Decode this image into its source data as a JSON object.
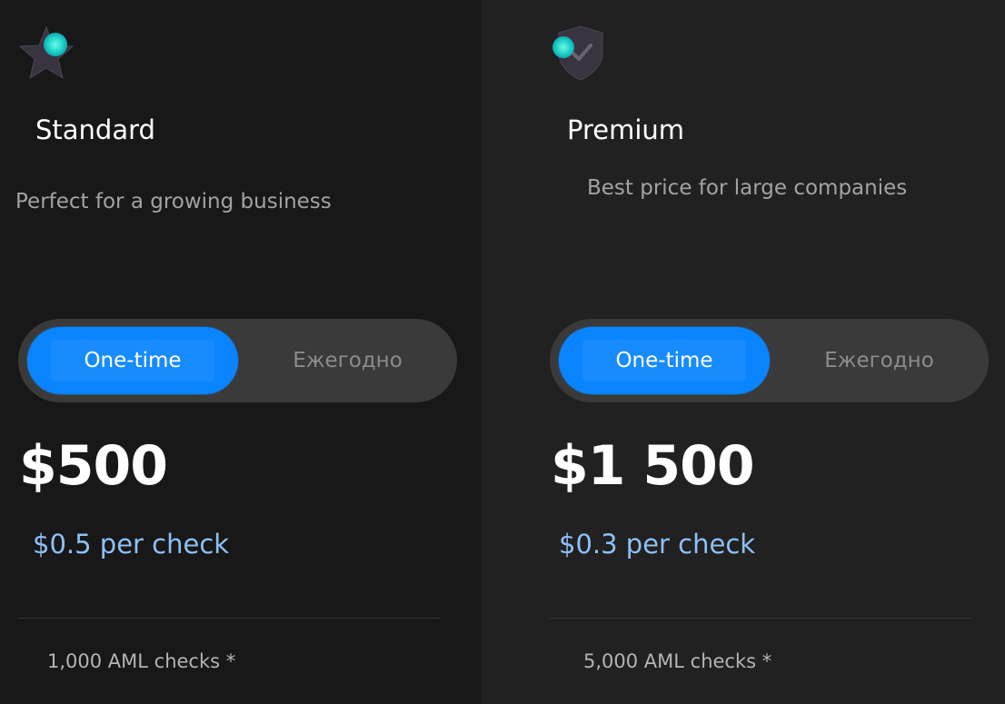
{
  "plans": [
    {
      "id": "standard",
      "icon": "star-icon",
      "title": "Standard",
      "subtitle": "Perfect for a growing business",
      "toggle": {
        "active": "One-time",
        "inactive": "Ежегодно"
      },
      "price": "$500",
      "per_check": "$0.5 per check",
      "feature": "1,000 AML checks *"
    },
    {
      "id": "premium",
      "icon": "shield-check-icon",
      "title": "Premium",
      "subtitle": "Best price for large companies",
      "toggle": {
        "active": "One-time",
        "inactive": "Ежегодно"
      },
      "price": "$1 500",
      "per_check": "$0.3 per check",
      "feature": "5,000 AML checks *"
    }
  ],
  "colors": {
    "accent": "#0a84ff",
    "per_check": "#8ec0f5",
    "icon_glow": "#2ee6d6"
  }
}
